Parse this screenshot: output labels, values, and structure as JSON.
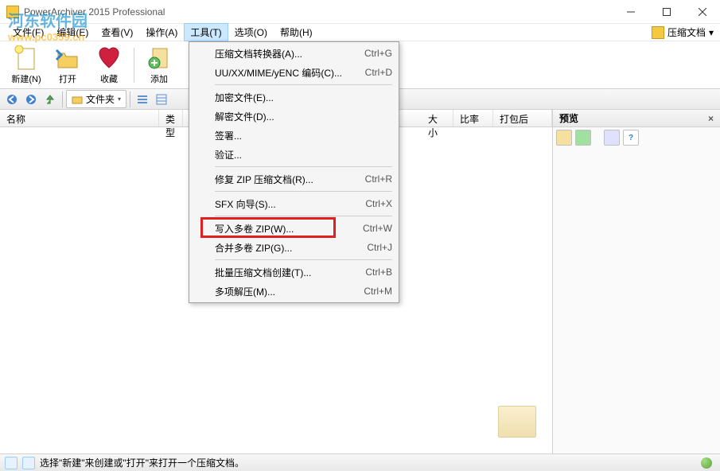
{
  "title": "PowerArchiver 2015 Professional",
  "watermark": {
    "text": "河东软件园",
    "url": "www.pc0359.cn"
  },
  "menubar": {
    "items": [
      {
        "label": "文件(F)"
      },
      {
        "label": "编辑(E)"
      },
      {
        "label": "查看(V)"
      },
      {
        "label": "操作(A)"
      },
      {
        "label": "工具(T)",
        "active": true
      },
      {
        "label": "选项(O)"
      },
      {
        "label": "帮助(H)"
      }
    ],
    "right": {
      "label": "压缩文档",
      "arrow": "▾"
    }
  },
  "toolbar": {
    "new": "新建(N)",
    "open": "打开",
    "favorites": "收藏",
    "add": "添加"
  },
  "navbar": {
    "folders": "文件夹",
    "arrow": "▾"
  },
  "columns": {
    "name": "名称",
    "type": "类型",
    "size": "大小",
    "ratio": "比率",
    "packed": "打包后"
  },
  "preview": {
    "title": "预览",
    "close": "×"
  },
  "status": {
    "text": "选择\"新建\"来创建或\"打开\"来打开一个压缩文档。"
  },
  "dropdown": {
    "items": [
      {
        "label": "压缩文档转换器(A)...",
        "shortcut": "Ctrl+G"
      },
      {
        "label": "UU/XX/MIME/yENC 编码(C)...",
        "shortcut": "Ctrl+D"
      },
      {
        "sep": true
      },
      {
        "label": "加密文件(E)...",
        "shortcut": ""
      },
      {
        "label": "解密文件(D)...",
        "shortcut": ""
      },
      {
        "label": "签署...",
        "shortcut": ""
      },
      {
        "label": "验证...",
        "shortcut": ""
      },
      {
        "sep": true
      },
      {
        "label": "修复 ZIP 压缩文档(R)...",
        "shortcut": "Ctrl+R"
      },
      {
        "sep": true
      },
      {
        "label": "SFX 向导(S)...",
        "shortcut": "Ctrl+X"
      },
      {
        "sep": true
      },
      {
        "label": "写入多卷 ZIP(W)...",
        "shortcut": "Ctrl+W",
        "highlight": true
      },
      {
        "label": "合并多卷 ZIP(G)...",
        "shortcut": "Ctrl+J"
      },
      {
        "sep": true
      },
      {
        "label": "批量压缩文档创建(T)...",
        "shortcut": "Ctrl+B"
      },
      {
        "label": "多项解压(M)...",
        "shortcut": "Ctrl+M"
      }
    ]
  }
}
